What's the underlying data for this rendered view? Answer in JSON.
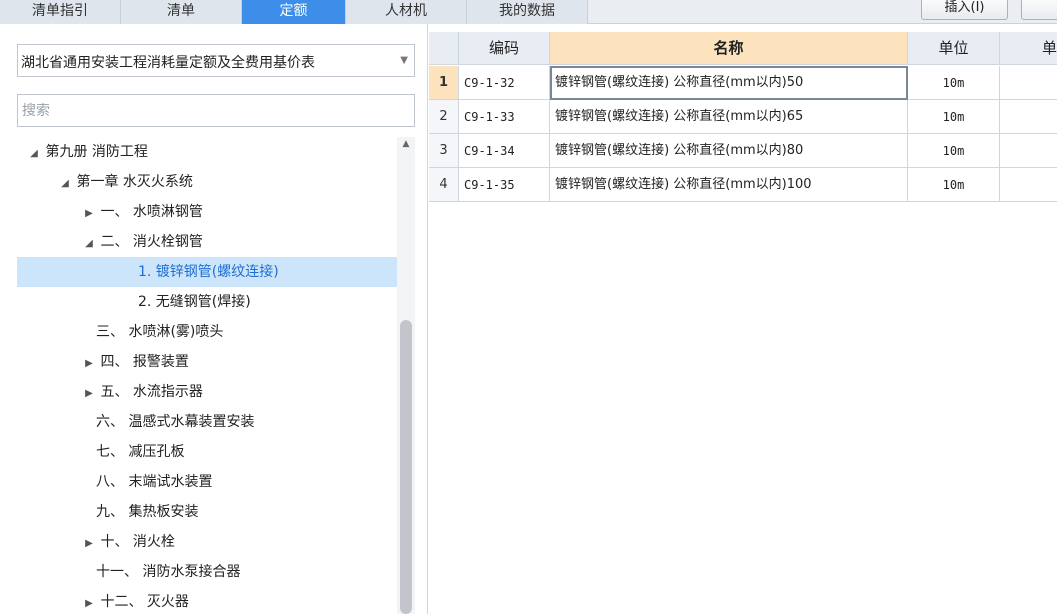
{
  "tabs": [
    {
      "label": "清单指引",
      "active": false
    },
    {
      "label": "清单",
      "active": false
    },
    {
      "label": "定额",
      "active": true
    },
    {
      "label": "人材机",
      "active": false
    },
    {
      "label": "我的数据",
      "active": false
    }
  ],
  "toolbar": {
    "insert_label": "插入(I)"
  },
  "left": {
    "library_select": "湖北省通用安装工程消耗量定额及全费用基价表",
    "search_placeholder": "搜索",
    "tree": [
      {
        "toggle": "◢",
        "label": "第九册 消防工程",
        "selected": false
      },
      {
        "toggle": "◢",
        "label": "第一章 水灭火系统",
        "selected": false
      },
      {
        "toggle": "▶",
        "label": "一、 水喷淋钢管",
        "selected": false
      },
      {
        "toggle": "◢",
        "label": "二、 消火栓钢管",
        "selected": false
      },
      {
        "toggle": "",
        "label": "1. 镀锌钢管(螺纹连接)",
        "selected": true
      },
      {
        "toggle": "",
        "label": "2. 无缝钢管(焊接)",
        "selected": false
      },
      {
        "toggle": "",
        "label": "三、 水喷淋(雾)喷头",
        "selected": false
      },
      {
        "toggle": "▶",
        "label": "四、 报警装置",
        "selected": false
      },
      {
        "toggle": "▶",
        "label": "五、 水流指示器",
        "selected": false
      },
      {
        "toggle": "",
        "label": "六、 温感式水幕装置安装",
        "selected": false
      },
      {
        "toggle": "",
        "label": "七、 减压孔板",
        "selected": false
      },
      {
        "toggle": "",
        "label": "八、 末端试水装置",
        "selected": false
      },
      {
        "toggle": "",
        "label": "九、 集热板安装",
        "selected": false
      },
      {
        "toggle": "▶",
        "label": "十、 消火栓",
        "selected": false
      },
      {
        "toggle": "",
        "label": "十一、 消防水泵接合器",
        "selected": false
      },
      {
        "toggle": "▶",
        "label": "十二、 灭火器",
        "selected": false
      }
    ]
  },
  "table": {
    "headers": {
      "code": "编码",
      "name": "名称",
      "unit": "单位",
      "extra": "单"
    },
    "rows": [
      {
        "idx": "1",
        "code": "C9-1-32",
        "name": "镀锌钢管(螺纹连接) 公称直径(mm以内)50",
        "unit": "10m",
        "current": true
      },
      {
        "idx": "2",
        "code": "C9-1-33",
        "name": "镀锌钢管(螺纹连接) 公称直径(mm以内)65",
        "unit": "10m",
        "current": false
      },
      {
        "idx": "3",
        "code": "C9-1-34",
        "name": "镀锌钢管(螺纹连接) 公称直径(mm以内)80",
        "unit": "10m",
        "current": false
      },
      {
        "idx": "4",
        "code": "C9-1-35",
        "name": "镀锌钢管(螺纹连接) 公称直径(mm以内)100",
        "unit": "10m",
        "current": false
      }
    ]
  }
}
